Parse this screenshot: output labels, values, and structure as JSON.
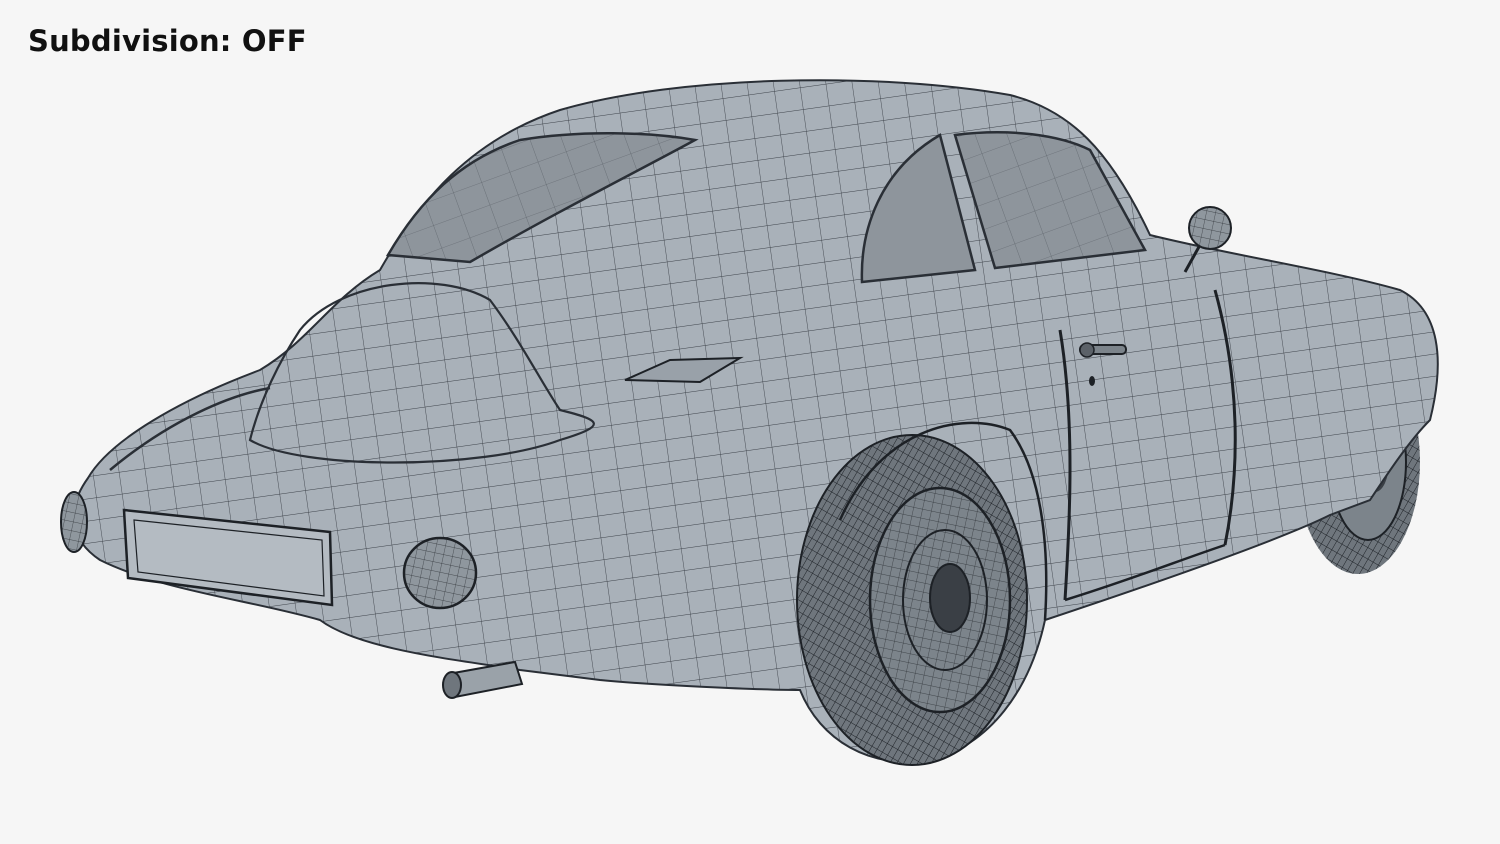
{
  "overlay": {
    "subdivision_label": "Subdivision:",
    "subdivision_state": "OFF"
  },
  "render": {
    "background_color": "#f6f6f6",
    "body_color": "#a9b1b9",
    "wire_color": "#2a2f36",
    "glass_color": "#8e959c",
    "tire_color": "#6f767d"
  }
}
